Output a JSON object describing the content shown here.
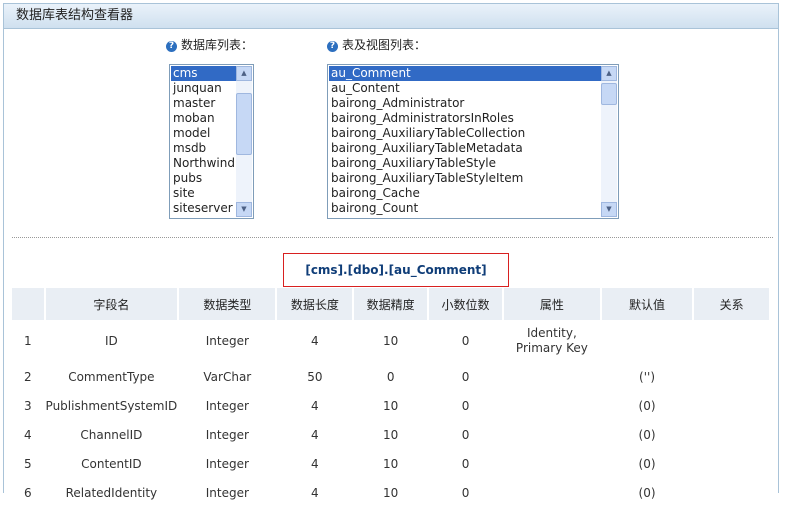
{
  "page": {
    "title": "数据库表结构查看器"
  },
  "db_list": {
    "label": "数据库列表：",
    "items": [
      "cms",
      "junquan",
      "master",
      "moban",
      "model",
      "msdb",
      "Northwind",
      "pubs",
      "site",
      "siteserver"
    ],
    "selected": "cms"
  },
  "table_list": {
    "label": "表及视图列表：",
    "items": [
      "au_Comment",
      "au_Content",
      "bairong_Administrator",
      "bairong_AdministratorsInRoles",
      "bairong_AuxiliaryTableCollection",
      "bairong_AuxiliaryTableMetadata",
      "bairong_AuxiliaryTableStyle",
      "bairong_AuxiliaryTableStyleItem",
      "bairong_Cache",
      "bairong_Count"
    ],
    "selected": "au_Comment"
  },
  "current_table": "[cms].[dbo].[au_Comment]",
  "columns_table": {
    "headers": [
      "",
      "字段名",
      "数据类型",
      "数据长度",
      "数据精度",
      "小数位数",
      "属性",
      "默认值",
      "关系"
    ],
    "rows": [
      [
        "1",
        "ID",
        "Integer",
        "4",
        "10",
        "0",
        "Identity, Primary Key",
        "",
        ""
      ],
      [
        "2",
        "CommentType",
        "VarChar",
        "50",
        "0",
        "0",
        "",
        "('')",
        ""
      ],
      [
        "3",
        "PublishmentSystemID",
        "Integer",
        "4",
        "10",
        "0",
        "",
        "(0)",
        ""
      ],
      [
        "4",
        "ChannelID",
        "Integer",
        "4",
        "10",
        "0",
        "",
        "(0)",
        ""
      ],
      [
        "5",
        "ContentID",
        "Integer",
        "4",
        "10",
        "0",
        "",
        "(0)",
        ""
      ],
      [
        "6",
        "RelatedIdentity",
        "Integer",
        "4",
        "10",
        "0",
        "",
        "(0)",
        ""
      ]
    ]
  },
  "colors": {
    "selection": "#316ac5",
    "title_border": "#d82020",
    "header_bg": "#e9eef4"
  }
}
